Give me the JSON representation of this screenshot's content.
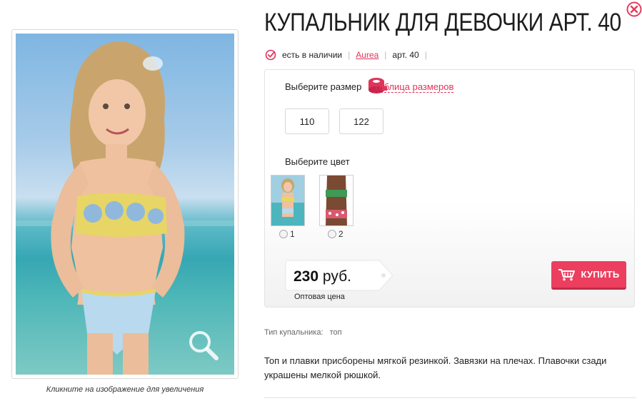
{
  "product": {
    "title": "КУПАЛЬНИК ДЛЯ ДЕВОЧКИ АРТ. 40",
    "availability": "есть в наличии",
    "brand": "Aurea",
    "article": "арт. 40"
  },
  "image": {
    "caption": "Кликните на изображение для увеличения"
  },
  "options": {
    "size_label": "Выберите размер",
    "size_table_link": "Таблица размеров",
    "sizes": [
      "110",
      "122"
    ],
    "color_label": "Выберите цвет",
    "colors": [
      {
        "number": "1"
      },
      {
        "number": "2"
      }
    ]
  },
  "price": {
    "amount": "230",
    "currency": "руб.",
    "note": "Оптовая цена"
  },
  "buy_button": "КУПИТЬ",
  "properties": [
    {
      "name": "Тип купальника:",
      "value": "топ"
    }
  ],
  "description": "Топ и плавки присборены мягкой резинкой. Завязки на плечах. Плавочки сзади украшены мелкой рюшкой.",
  "colors": {
    "accent": "#ec3e5e",
    "link": "#e0345a"
  },
  "icons": [
    "zoom-icon",
    "close-icon",
    "check-circle-icon",
    "measuring-tape-icon",
    "cart-icon"
  ]
}
